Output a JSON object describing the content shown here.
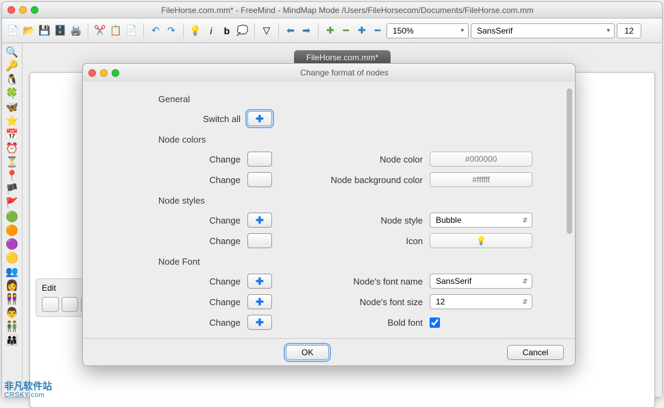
{
  "window": {
    "title": "FileHorse.com.mm* - FreeMind - MindMap Mode /Users/FileHorsecom/Documents/FileHorse.com.mm",
    "tab": "FileHorse.com.mm*"
  },
  "toolbar": {
    "zoom": "150%",
    "font": "SansSerif",
    "size": "12"
  },
  "editpanel": {
    "label": "Edit"
  },
  "dialog": {
    "title": "Change format of nodes",
    "sections": {
      "general": "General",
      "switch_all": "Switch all",
      "node_colors": "Node colors",
      "change": "Change",
      "node_color": "Node color",
      "node_color_value": "#000000",
      "node_bg": "Node background color",
      "node_bg_value": "#ffffff",
      "node_styles": "Node styles",
      "node_style": "Node style",
      "node_style_value": "Bubble",
      "icon": "Icon",
      "node_font": "Node Font",
      "font_name": "Node's font name",
      "font_name_value": "SansSerif",
      "font_size": "Node's font size",
      "font_size_value": "12",
      "bold": "Bold font"
    },
    "buttons": {
      "ok": "OK",
      "cancel": "Cancel"
    }
  },
  "watermark": {
    "cn": "非凡软件站",
    "en": "CRSKY.com"
  }
}
